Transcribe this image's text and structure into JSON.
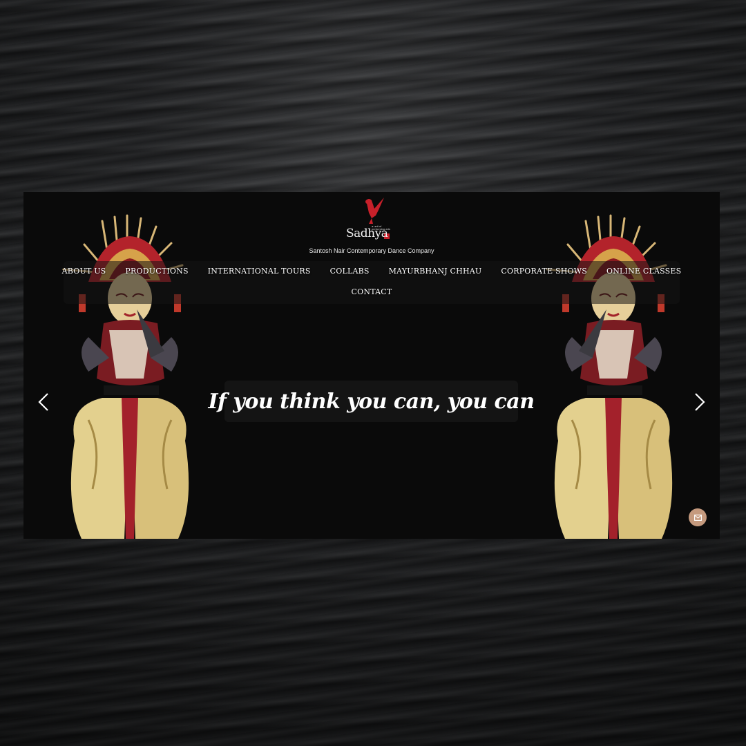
{
  "brand": {
    "name": "Sadhya",
    "tagline": "a unit of performing arts",
    "company": "Santosh Nair Contemporary Dance Company"
  },
  "nav": {
    "items": [
      {
        "label": "About Us"
      },
      {
        "label": "Productions"
      },
      {
        "label": "International Tours"
      },
      {
        "label": "Collabs"
      },
      {
        "label": "Mayurbhanj Chhau"
      },
      {
        "label": "Corporate Shows"
      },
      {
        "label": "Online Classes"
      }
    ],
    "contact": "Contact"
  },
  "hero": {
    "quote": "If you think you can, you can"
  },
  "icons": {
    "prev": "chevron-left-icon",
    "next": "chevron-right-icon",
    "mail": "envelope-icon",
    "logo": "dancer-logo-icon"
  },
  "colors": {
    "site_bg": "#0a0a0a",
    "accent": "#c8202a",
    "mail_button": "#c59a7e",
    "text": "#ffffff"
  }
}
